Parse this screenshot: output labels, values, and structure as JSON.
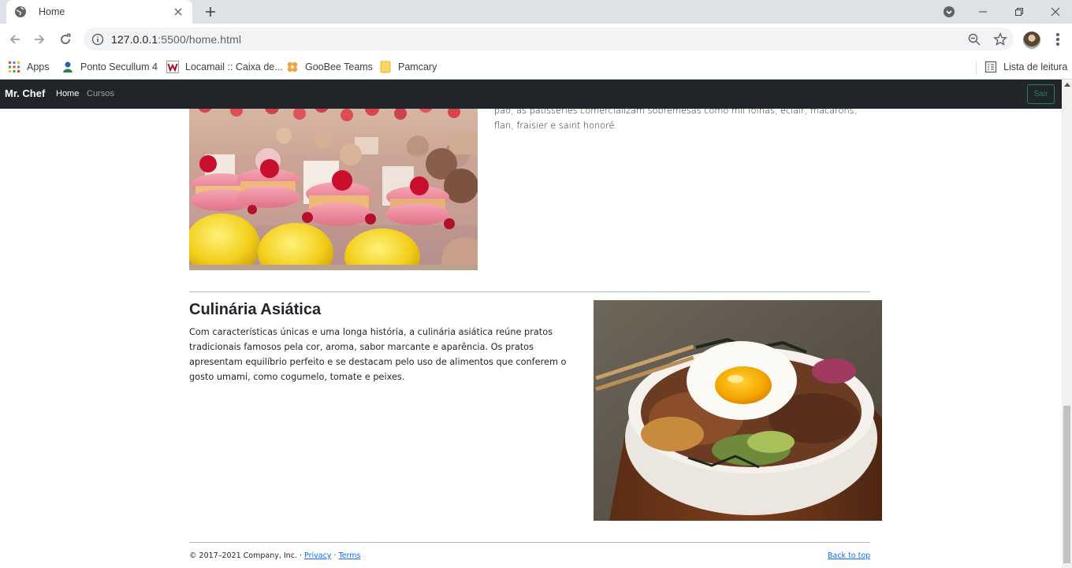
{
  "browser": {
    "tab": {
      "title": "Home"
    },
    "address": {
      "host": "127.0.0.1",
      "path": ":5500/home.html"
    },
    "bookmarks": [
      {
        "label": "Apps",
        "icon": "apps-grid-icon"
      },
      {
        "label": "Ponto Secullum 4",
        "icon": "secullum-icon"
      },
      {
        "label": "Locamail :: Caixa de...",
        "icon": "locamail-icon"
      },
      {
        "label": "GooBee Teams",
        "icon": "goobee-icon"
      },
      {
        "label": "Pamcary",
        "icon": "folder-icon"
      }
    ],
    "reading_list": "Lista de leitura"
  },
  "navbar": {
    "brand": "Mr. Chef",
    "links": [
      "Home",
      "Cursos"
    ],
    "button": "Sair"
  },
  "sections": {
    "pastry_text": "pão, as patisseries comercializam sobremesas como mil folhas, eclair, macarons, flan, fraisier e saint honoré.",
    "asian_title": "Culinária Asiática",
    "asian_text": "Com características únicas e uma longa história, a culinária asiática reúne pratos tradicionais famosos pela cor, aroma, sabor marcante e aparência. Os pratos apresentam equilíbrio perfeito e se destacam pelo uso de alimentos que conferem o gosto umami, como cogumelo, tomate e peixes."
  },
  "footer": {
    "copyright": "© 2017–2021 Company, Inc. · ",
    "privacy": "Privacy",
    "sep": " · ",
    "terms": "Terms",
    "back_to_top": "Back to top"
  }
}
